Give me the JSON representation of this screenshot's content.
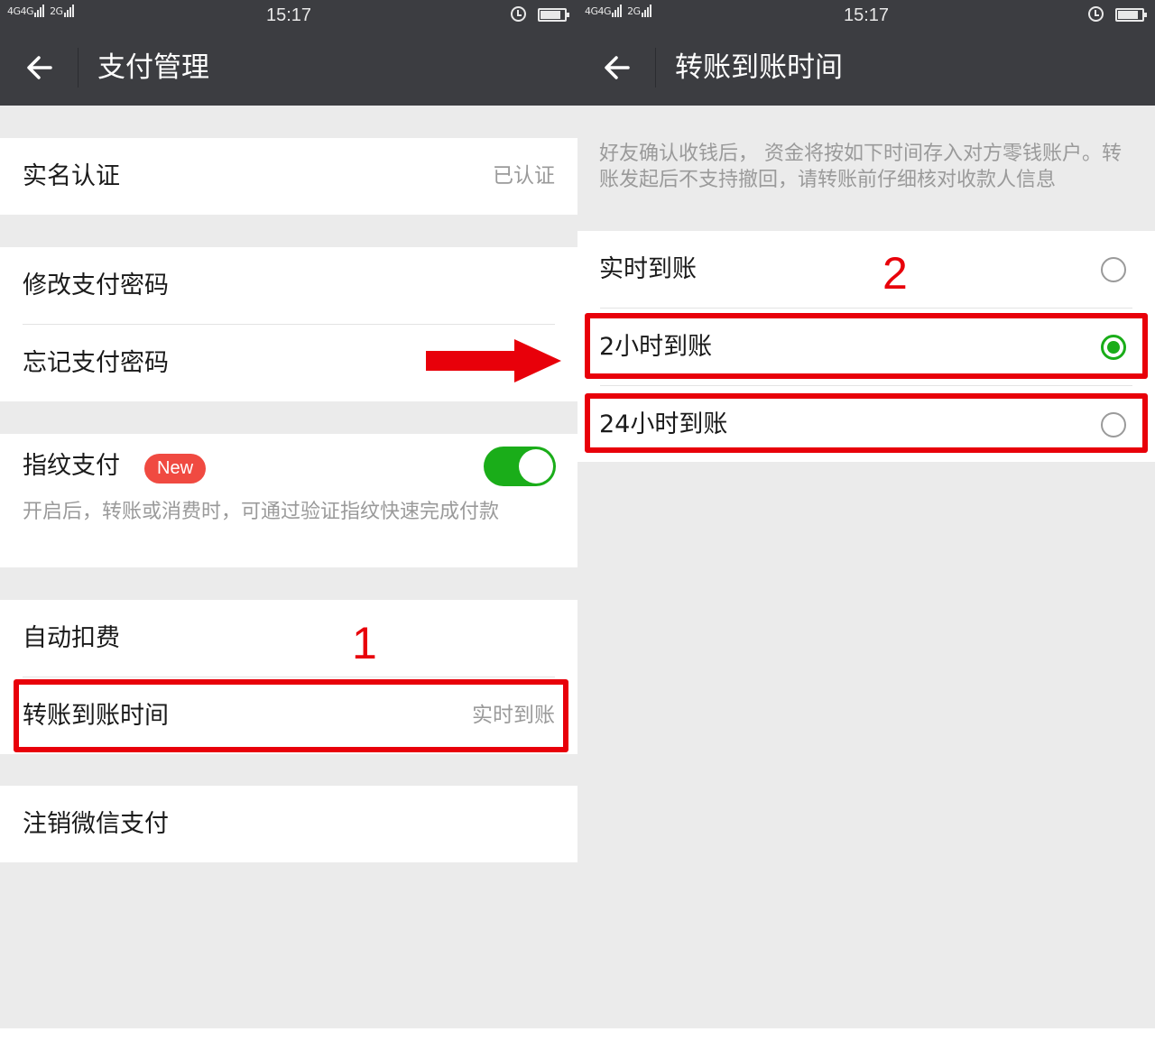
{
  "statusbar": {
    "network_1": "4G",
    "network_2": "4G",
    "network_3": "2G",
    "time": "15:17"
  },
  "left": {
    "nav": {
      "title": "支付管理"
    },
    "rows": {
      "real_name": {
        "label": "实名认证",
        "value": "已认证"
      },
      "change_password": {
        "label": "修改支付密码"
      },
      "forgot_password": {
        "label": "忘记支付密码"
      },
      "fingerprint": {
        "label": "指纹支付",
        "badge": "New",
        "toggle_on": true,
        "desc": "开启后，转账或消费时，可通过验证指纹快速完成付款"
      },
      "auto_deduct": {
        "label": "自动扣费"
      },
      "transfer_time": {
        "label": "转账到账时间",
        "value": "实时到账"
      },
      "cancel_pay": {
        "label": "注销微信支付"
      }
    },
    "annotation": "1"
  },
  "right": {
    "nav": {
      "title": "转账到账时间"
    },
    "desc": "好友确认收钱后， 资金将按如下时间存入对方零钱账户。转账发起后不支持撤回，请转账前仔细核对收款人信息",
    "options": [
      {
        "label": "实时到账",
        "checked": false
      },
      {
        "label": "2小时到账",
        "checked": true
      },
      {
        "label": "24小时到账",
        "checked": false
      }
    ],
    "annotation": "2"
  },
  "colors": {
    "navbar_bg": "#3c3d41",
    "page_bg": "#ebebeb",
    "accent_green": "#1aad19",
    "badge_red": "#f04a41",
    "annotation_red": "#e8000a",
    "secondary_text": "#9a9a9a"
  },
  "icons": {
    "back": "arrow-left-icon",
    "alarm": "alarm-clock-icon",
    "battery": "battery-icon",
    "annotation_arrow": "arrow-right-icon"
  }
}
